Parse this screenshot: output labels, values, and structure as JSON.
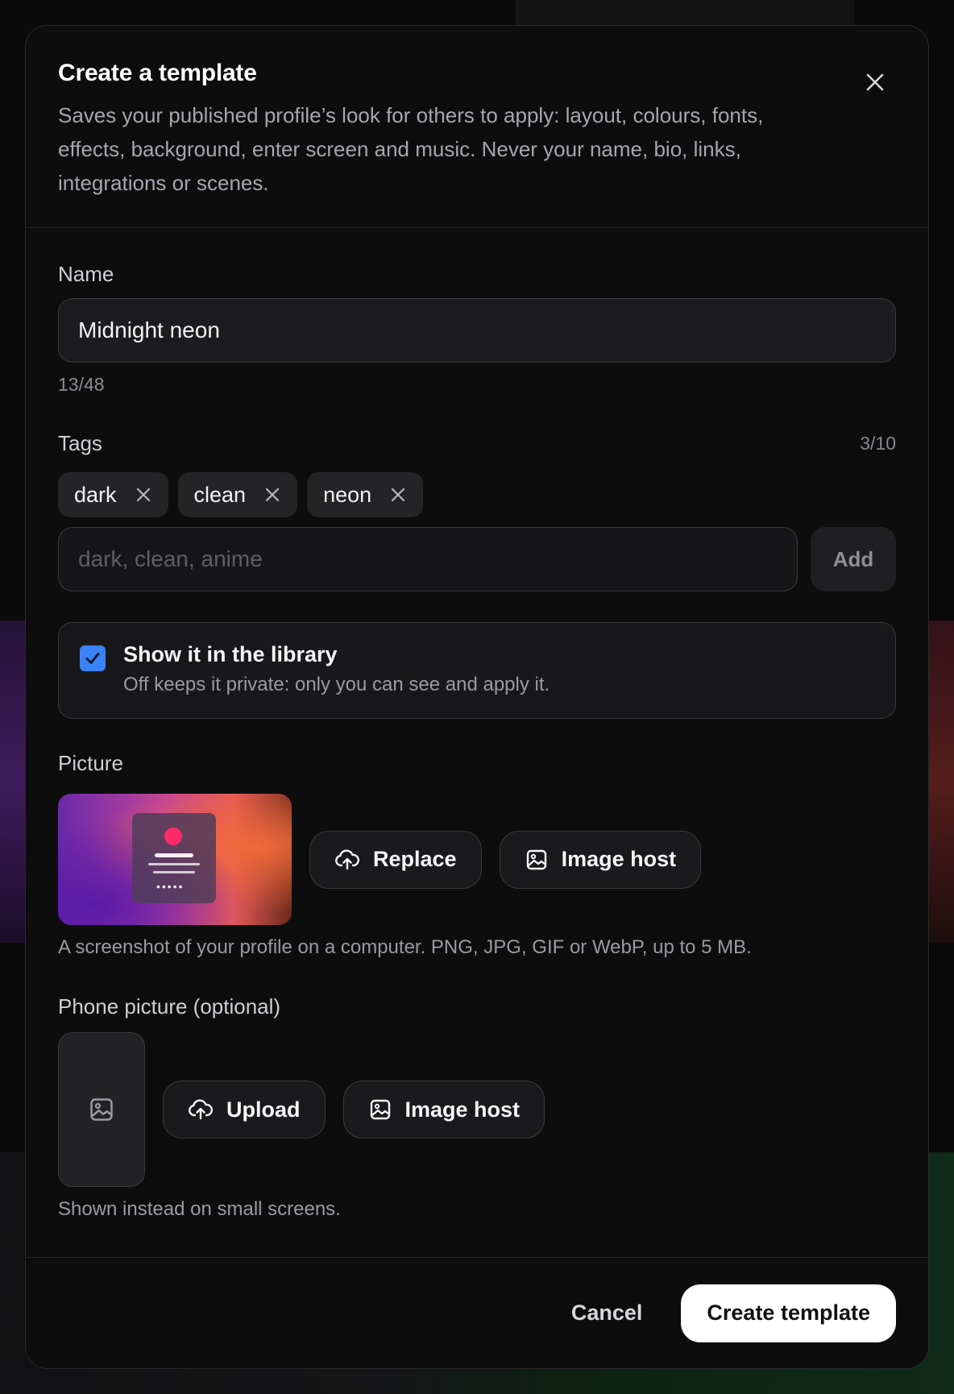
{
  "modal": {
    "title": "Create a template",
    "description": "Saves your published profile’s look for others to apply: layout, colours, fonts, effects, background, enter screen and music. Never your name, bio, links, integrations or scenes."
  },
  "name_field": {
    "label": "Name",
    "value": "Midnight neon",
    "counter": "13/48"
  },
  "tags": {
    "label": "Tags",
    "counter": "3/10",
    "chips": [
      "dark",
      "clean",
      "neon"
    ],
    "input_placeholder": "dark, clean, anime",
    "add_label": "Add"
  },
  "library": {
    "checked": true,
    "title": "Show it in the library",
    "subtitle": "Off keeps it private: only you can see and apply it."
  },
  "picture": {
    "label": "Picture",
    "replace_label": "Replace",
    "image_host_label": "Image host",
    "hint": "A screenshot of your profile on a computer. PNG, JPG, GIF or WebP, up to 5 MB."
  },
  "phone_picture": {
    "label": "Phone picture (optional)",
    "upload_label": "Upload",
    "image_host_label": "Image host",
    "hint": "Shown instead on small screens."
  },
  "footer": {
    "cancel_label": "Cancel",
    "create_label": "Create template"
  },
  "colors": {
    "accent_checkbox": "#3b82f6",
    "primary_button": "#ffffff",
    "background": "#0d0d0e"
  },
  "icons": {
    "close": "close-icon",
    "chip_remove": "x-icon",
    "upload": "cloud-upload-icon",
    "image_host": "image-icon",
    "phone_placeholder": "image-icon",
    "checkbox": "check-icon"
  }
}
